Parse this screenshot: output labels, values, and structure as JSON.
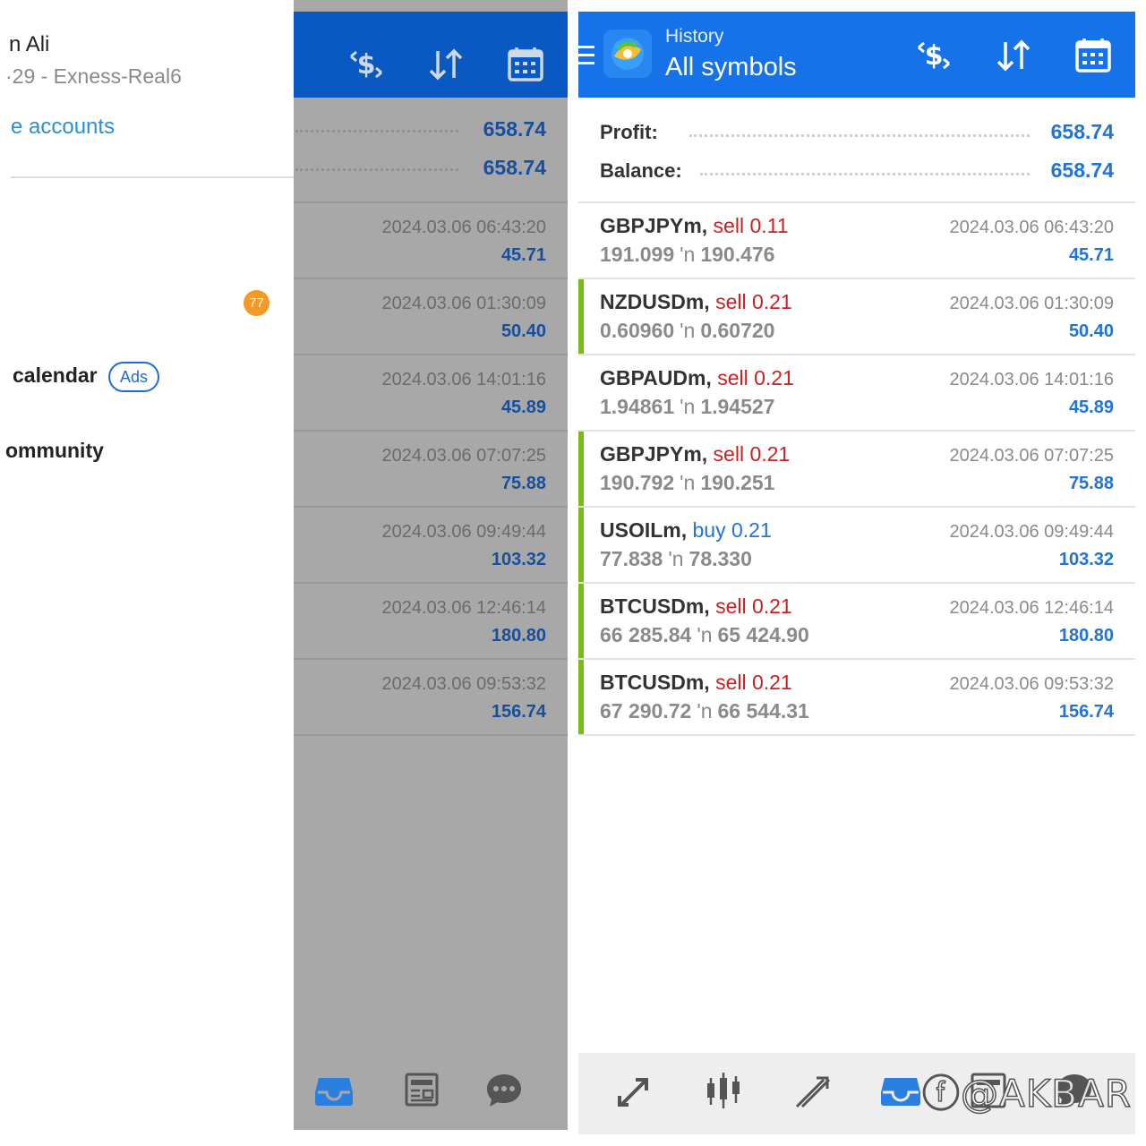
{
  "drawer": {
    "account_name": "n Ali",
    "account_server": "·29 - Exness-Real6",
    "manage_accounts": "e accounts",
    "badge_count": "77",
    "menu_calendar": "calendar",
    "ads_label": "Ads",
    "menu_community": "ommunity"
  },
  "header": {
    "subtitle": "History",
    "title": "All symbols",
    "icons": [
      "deposit-dollar-icon",
      "sort-icon",
      "calendar-icon"
    ]
  },
  "summary": {
    "profit_label": "Profit:",
    "profit_value": "658.74",
    "balance_label": "Balance:",
    "balance_value": "658.74"
  },
  "trades": [
    {
      "symbol": "GBPJPYm,",
      "side": "sell 0.11",
      "side_type": "sell",
      "open": "191.099",
      "close": "190.476",
      "time": "2024.03.06 06:43:20",
      "profit": "45.71",
      "accent": false
    },
    {
      "symbol": "NZDUSDm,",
      "side": "sell 0.21",
      "side_type": "sell",
      "open": "0.60960",
      "close": "0.60720",
      "time": "2024.03.06 01:30:09",
      "profit": "50.40",
      "accent": true
    },
    {
      "symbol": "GBPAUDm,",
      "side": "sell 0.21",
      "side_type": "sell",
      "open": "1.94861",
      "close": "1.94527",
      "time": "2024.03.06 14:01:16",
      "profit": "45.89",
      "accent": false
    },
    {
      "symbol": "GBPJPYm,",
      "side": "sell 0.21",
      "side_type": "sell",
      "open": "190.792",
      "close": "190.251",
      "time": "2024.03.06 07:07:25",
      "profit": "75.88",
      "accent": true
    },
    {
      "symbol": "USOILm,",
      "side": "buy 0.21",
      "side_type": "buy",
      "open": "77.838",
      "close": "78.330",
      "time": "2024.03.06 09:49:44",
      "profit": "103.32",
      "accent": true
    },
    {
      "symbol": "BTCUSDm,",
      "side": "sell 0.21",
      "side_type": "sell",
      "open": "66 285.84",
      "close": "65 424.90",
      "time": "2024.03.06 12:46:14",
      "profit": "180.80",
      "accent": true
    },
    {
      "symbol": "BTCUSDm,",
      "side": "sell 0.21",
      "side_type": "sell",
      "open": "67 290.72",
      "close": "66 544.31",
      "time": "2024.03.06 09:53:32",
      "profit": "156.74",
      "accent": true
    }
  ],
  "price_arrow": "'n",
  "bottom_nav": [
    "quotes-icon",
    "chart-icon",
    "trade-icon",
    "history-icon",
    "news-icon",
    "messages-icon"
  ],
  "watermark": "ⓕ@AKBAR",
  "colors": {
    "toolbar_blue": "#1672e8",
    "profit_blue": "#1f74d6",
    "sell_red": "#cc2020",
    "accent_green": "#7cba1b",
    "badge_orange": "#f39a24"
  }
}
